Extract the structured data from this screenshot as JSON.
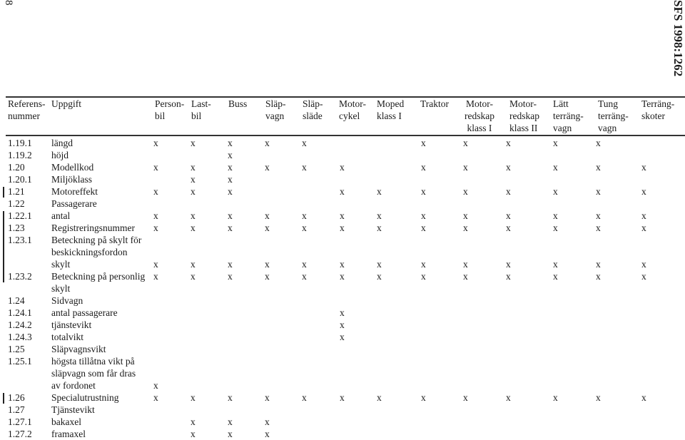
{
  "page_number": "8",
  "running_head": "SFS 1998:1262",
  "table": {
    "headers": [
      "Referens-\nnummer",
      "Uppgift",
      "Person-\nbil",
      "Last-\nbil",
      "Buss",
      "Släp-\nvagn",
      "Släp-\nsläde",
      "Motor-\ncykel",
      "Moped\nklass I",
      "Traktor",
      "Motor-\nredskap\nklass I",
      "Motor-\nredskap\nklass II",
      "Lätt\nterräng-\nvagn",
      "Tung\nterräng-\nvagn",
      "Terräng-\nskoter"
    ],
    "rows": [
      {
        "ref": "1.19.1",
        "desc": "längd",
        "marks": [
          "x",
          "x",
          "x",
          "x",
          "x",
          "",
          "",
          "x",
          "x",
          "x",
          "x",
          "x",
          ""
        ]
      },
      {
        "ref": "1.19.2",
        "desc": "höjd",
        "marks": [
          "",
          "",
          "x",
          "",
          "",
          "",
          "",
          "",
          "",
          "",
          "",
          "",
          ""
        ]
      },
      {
        "ref": "1.20",
        "desc": "Modellkod",
        "marks": [
          "x",
          "x",
          "x",
          "x",
          "x",
          "x",
          "",
          "x",
          "x",
          "x",
          "x",
          "x",
          "x"
        ]
      },
      {
        "ref": "1.20.1",
        "desc": "Miljöklass",
        "marks": [
          "",
          "x",
          "x",
          "",
          "",
          "",
          "",
          "",
          "",
          "",
          "",
          "",
          ""
        ]
      },
      {
        "ref": "1.21",
        "desc": "Motoreffekt",
        "marks": [
          "x",
          "x",
          "x",
          "",
          "",
          "x",
          "x",
          "x",
          "x",
          "x",
          "x",
          "x",
          "x"
        ]
      },
      {
        "ref": "1.22",
        "desc": "Passagerare",
        "marks": [
          "",
          "",
          "",
          "",
          "",
          "",
          "",
          "",
          "",
          "",
          "",
          "",
          ""
        ]
      },
      {
        "ref": "1.22.1",
        "desc": "antal",
        "marks": [
          "x",
          "x",
          "x",
          "x",
          "x",
          "x",
          "x",
          "x",
          "x",
          "x",
          "x",
          "x",
          "x"
        ]
      },
      {
        "ref": "1.23",
        "desc": "Registreringsnummer",
        "marks": [
          "x",
          "x",
          "x",
          "x",
          "x",
          "x",
          "x",
          "x",
          "x",
          "x",
          "x",
          "x",
          "x"
        ]
      },
      {
        "ref": "1.23.1",
        "desc": "Beteckning på skylt för",
        "marks": [
          "",
          "",
          "",
          "",
          "",
          "",
          "",
          "",
          "",
          "",
          "",
          "",
          ""
        ]
      },
      {
        "ref": "",
        "desc": "beskickningsfordon",
        "marks": [
          "",
          "",
          "",
          "",
          "",
          "",
          "",
          "",
          "",
          "",
          "",
          "",
          ""
        ]
      },
      {
        "ref": "",
        "desc": "skylt",
        "marks": [
          "x",
          "x",
          "x",
          "x",
          "x",
          "x",
          "x",
          "x",
          "x",
          "x",
          "x",
          "x",
          "x"
        ]
      },
      {
        "ref": "1.23.2",
        "desc": "Beteckning på personlig",
        "marks": [
          "x",
          "x",
          "x",
          "x",
          "x",
          "x",
          "x",
          "x",
          "x",
          "x",
          "x",
          "x",
          "x"
        ]
      },
      {
        "ref": "",
        "desc": "skylt",
        "marks": [
          "",
          "",
          "",
          "",
          "",
          "",
          "",
          "",
          "",
          "",
          "",
          "",
          ""
        ]
      },
      {
        "ref": "1.24",
        "desc": "Sidvagn",
        "marks": [
          "",
          "",
          "",
          "",
          "",
          "",
          "",
          "",
          "",
          "",
          "",
          "",
          ""
        ]
      },
      {
        "ref": "1.24.1",
        "desc": "antal passagerare",
        "marks": [
          "",
          "",
          "",
          "",
          "",
          "x",
          "",
          "",
          "",
          "",
          "",
          "",
          ""
        ]
      },
      {
        "ref": "1.24.2",
        "desc": "tjänstevikt",
        "marks": [
          "",
          "",
          "",
          "",
          "",
          "x",
          "",
          "",
          "",
          "",
          "",
          "",
          ""
        ]
      },
      {
        "ref": "1.24.3",
        "desc": "totalvikt",
        "marks": [
          "",
          "",
          "",
          "",
          "",
          "x",
          "",
          "",
          "",
          "",
          "",
          "",
          ""
        ]
      },
      {
        "ref": "1.25",
        "desc": "Släpvagnsvikt",
        "marks": [
          "",
          "",
          "",
          "",
          "",
          "",
          "",
          "",
          "",
          "",
          "",
          "",
          ""
        ]
      },
      {
        "ref": "1.25.1",
        "desc": "högsta tillåtna vikt på",
        "marks": [
          "",
          "",
          "",
          "",
          "",
          "",
          "",
          "",
          "",
          "",
          "",
          "",
          ""
        ]
      },
      {
        "ref": "",
        "desc": "släpvagn som får dras",
        "marks": [
          "",
          "",
          "",
          "",
          "",
          "",
          "",
          "",
          "",
          "",
          "",
          "",
          ""
        ]
      },
      {
        "ref": "",
        "desc": "av fordonet",
        "marks": [
          "x",
          "",
          "",
          "",
          "",
          "",
          "",
          "",
          "",
          "",
          "",
          "",
          ""
        ]
      },
      {
        "ref": "1.26",
        "desc": "Specialutrustning",
        "marks": [
          "x",
          "x",
          "x",
          "x",
          "x",
          "x",
          "x",
          "x",
          "x",
          "x",
          "x",
          "x",
          "x"
        ]
      },
      {
        "ref": "1.27",
        "desc": "Tjänstevikt",
        "marks": [
          "",
          "",
          "",
          "",
          "",
          "",
          "",
          "",
          "",
          "",
          "",
          "",
          ""
        ]
      },
      {
        "ref": "1.27.1",
        "desc": "bakaxel",
        "marks": [
          "",
          "x",
          "x",
          "x",
          "",
          "",
          "",
          "",
          "",
          "",
          "",
          "",
          ""
        ]
      },
      {
        "ref": "1.27.2",
        "desc": "framaxel",
        "marks": [
          "",
          "x",
          "x",
          "x",
          "",
          "",
          "",
          "",
          "",
          "",
          "",
          "",
          ""
        ]
      }
    ]
  }
}
